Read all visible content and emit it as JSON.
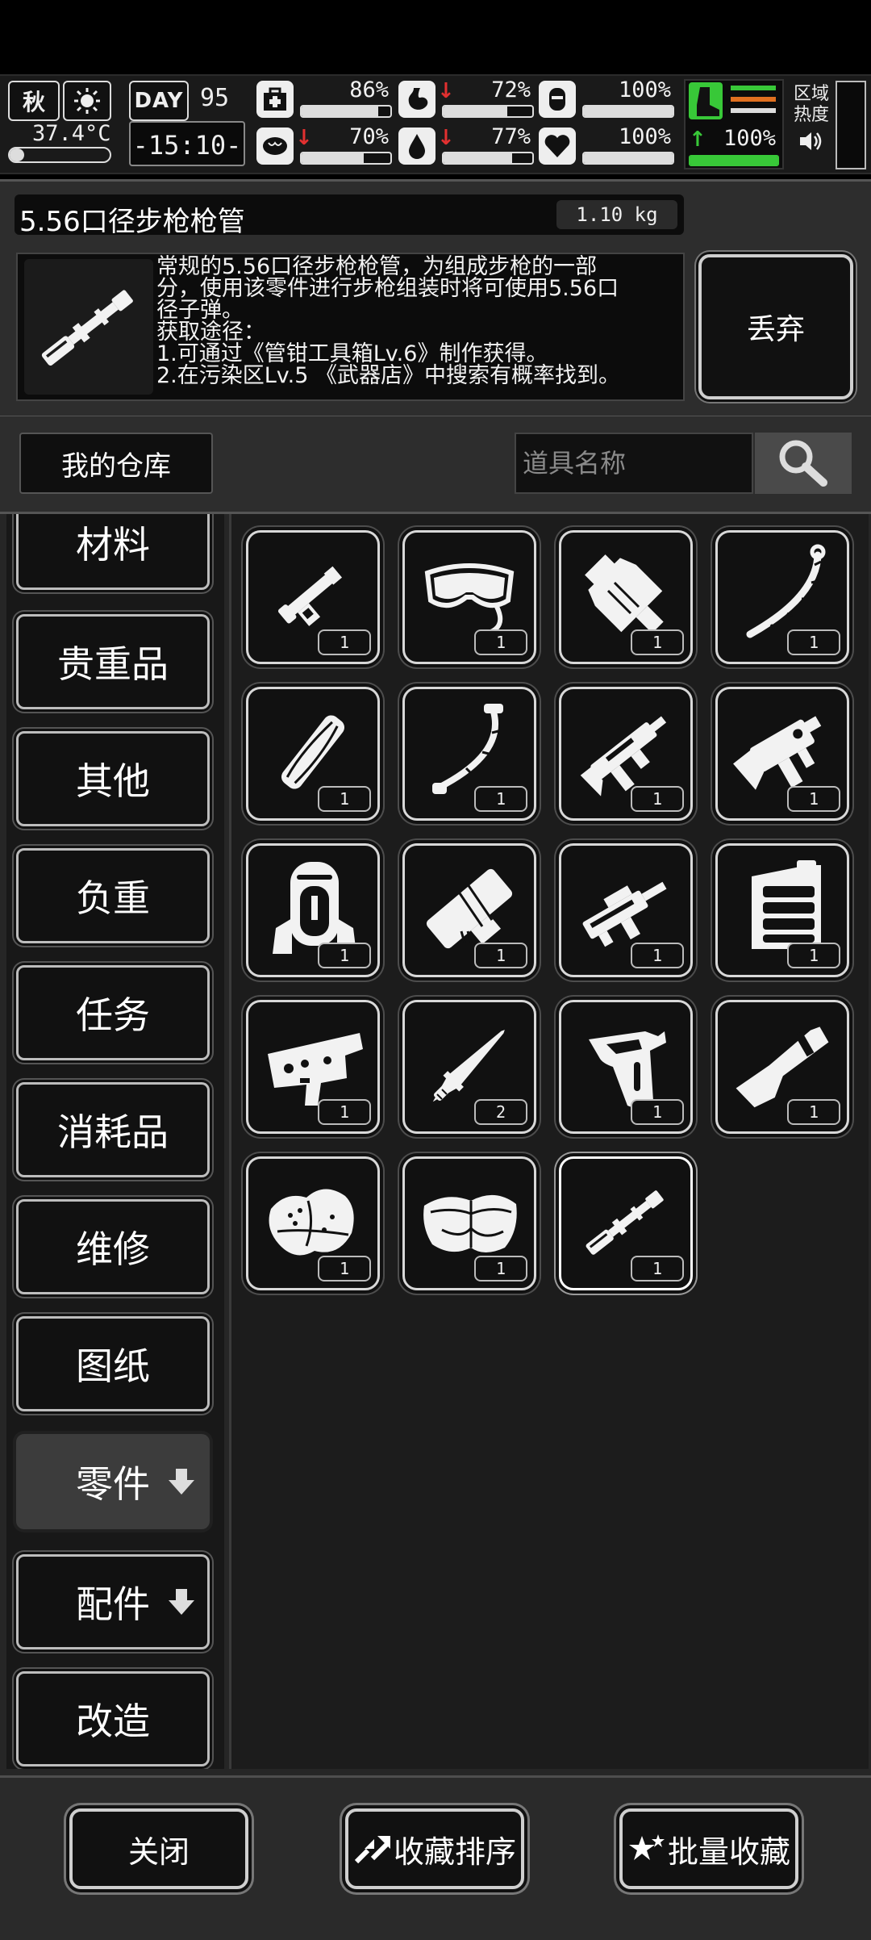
{
  "status": {
    "season": "秋",
    "temperature": "37.4°C",
    "day_label": "DAY",
    "day_number": "95",
    "clock": "-15:10-",
    "stats": [
      {
        "id": "health",
        "value": "86%",
        "level": 0.86,
        "trend": "none"
      },
      {
        "id": "hunger",
        "value": "72%",
        "level": 0.72,
        "trend": "down"
      },
      {
        "id": "armor",
        "value": "100%",
        "level": 1.0,
        "trend": "none"
      },
      {
        "id": "sanity",
        "value": "70%",
        "level": 0.7,
        "trend": "down"
      },
      {
        "id": "thirst",
        "value": "77%",
        "level": 0.77,
        "trend": "down"
      },
      {
        "id": "heart",
        "value": "100%",
        "level": 1.0,
        "trend": "none"
      }
    ],
    "stamina": {
      "value": "100%",
      "level": 1.0,
      "trend": "up"
    },
    "region_label": "区域热度"
  },
  "detail": {
    "title": "5.56口径步枪枪管",
    "weight": "1.10 kg",
    "description": "常规的5.56口径步枪枪管，为组成步枪的一部\n分，使用该零件进行步枪组装时将可使用5.56口\n径子弹。\n获取途径：\n1.可通过《管钳工具箱Lv.6》制作获得。\n2.在污染区Lv.5 《武器店》中搜索有概率找到。",
    "discard_label": "丢弃"
  },
  "search": {
    "warehouse_label": "我的仓库",
    "placeholder": "道具名称"
  },
  "categories": [
    {
      "label": "材料"
    },
    {
      "label": "贵重品"
    },
    {
      "label": "其他"
    },
    {
      "label": "负重"
    },
    {
      "label": "任务"
    },
    {
      "label": "消耗品"
    },
    {
      "label": "维修"
    },
    {
      "label": "图纸"
    },
    {
      "label": "零件",
      "active": true,
      "expand": true
    },
    {
      "label": "配件",
      "expand": true
    },
    {
      "label": "改造"
    }
  ],
  "items": [
    {
      "icon": "scope-part-icon",
      "count": "1"
    },
    {
      "icon": "goggles-icon",
      "count": "1"
    },
    {
      "icon": "muzzle-brake-icon",
      "count": "1"
    },
    {
      "icon": "sling-icon",
      "count": "1"
    },
    {
      "icon": "wood-handguard-icon",
      "count": "1"
    },
    {
      "icon": "strap-icon",
      "count": "1"
    },
    {
      "icon": "rifle-frame-icon",
      "count": "1"
    },
    {
      "icon": "lower-receiver-icon",
      "count": "1"
    },
    {
      "icon": "backpack-frame-icon",
      "count": "1"
    },
    {
      "icon": "handguard-block-icon",
      "count": "1"
    },
    {
      "icon": "rifle-upper-icon",
      "count": "1"
    },
    {
      "icon": "magazine-box-icon",
      "count": "1"
    },
    {
      "icon": "trigger-group-icon",
      "count": "1"
    },
    {
      "icon": "bayonet-icon",
      "count": "2"
    },
    {
      "icon": "pistol-grip-icon",
      "count": "1"
    },
    {
      "icon": "shotgun-stock-icon",
      "count": "1"
    },
    {
      "icon": "cloth-scrap-icon",
      "count": "1"
    },
    {
      "icon": "fabric-bundle-icon",
      "count": "1"
    },
    {
      "icon": "rifle-barrel-icon",
      "count": "1",
      "selected": true
    }
  ],
  "bottom": {
    "close_label": "关闭",
    "sort_label": "收藏排序",
    "batch_label": "批量收藏"
  },
  "colors": {
    "accent_green": "#38c838",
    "warning_red": "#e23030",
    "panel": "#2d2d2d"
  }
}
